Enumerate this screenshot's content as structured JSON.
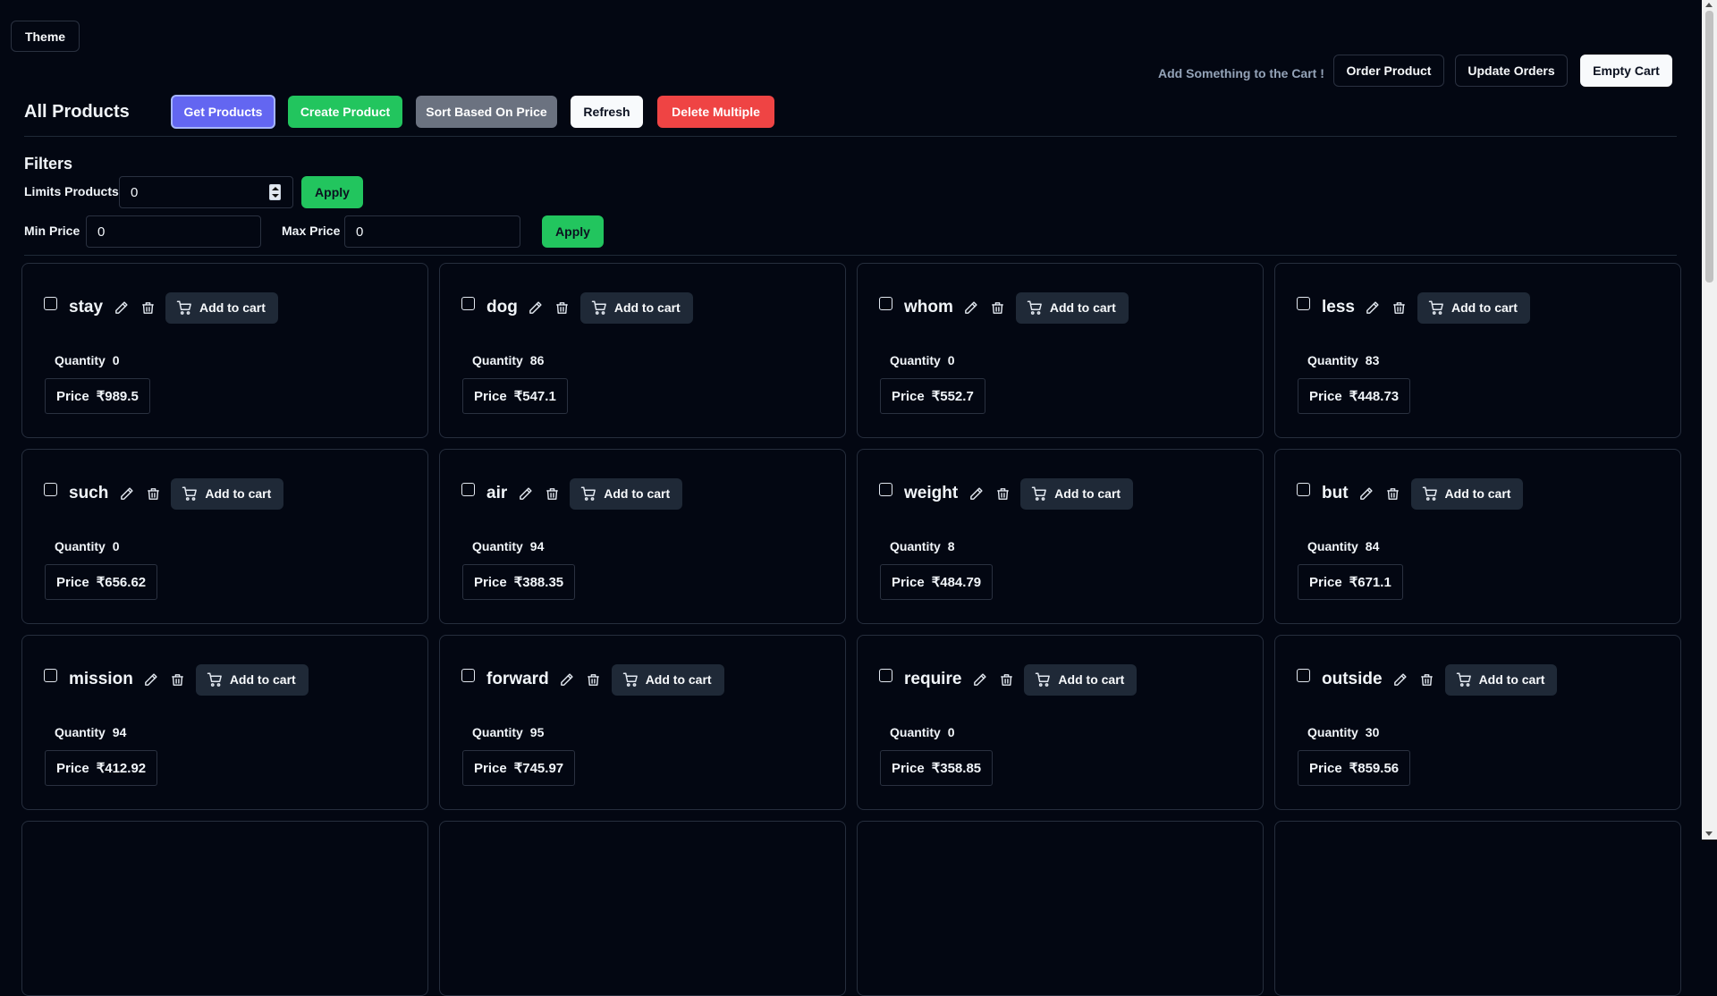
{
  "header": {
    "theme_label": "Theme",
    "cart_message": "Add Something to the Cart !",
    "order_product_label": "Order Product",
    "update_orders_label": "Update Orders",
    "empty_cart_label": "Empty Cart"
  },
  "toolbar": {
    "title": "All Products",
    "get_products_label": "Get Products",
    "create_product_label": "Create Product",
    "sort_label": "Sort Based On Price",
    "refresh_label": "Refresh",
    "delete_multiple_label": "Delete Multiple"
  },
  "filters": {
    "title": "Filters",
    "limit_label": "Limits Products",
    "limit_value": "0",
    "apply_label": "Apply",
    "min_price_label": "Min Price",
    "min_price_value": "0",
    "max_price_label": "Max Price",
    "max_price_value": "0"
  },
  "card_labels": {
    "add_to_cart": "Add to cart",
    "quantity": "Quantity",
    "price": "Price"
  },
  "products": [
    {
      "name": "stay",
      "quantity": "0",
      "price": "₹989.5"
    },
    {
      "name": "dog",
      "quantity": "86",
      "price": "₹547.1"
    },
    {
      "name": "whom",
      "quantity": "0",
      "price": "₹552.7"
    },
    {
      "name": "less",
      "quantity": "83",
      "price": "₹448.73"
    },
    {
      "name": "such",
      "quantity": "0",
      "price": "₹656.62"
    },
    {
      "name": "air",
      "quantity": "94",
      "price": "₹388.35"
    },
    {
      "name": "weight",
      "quantity": "8",
      "price": "₹484.79"
    },
    {
      "name": "but",
      "quantity": "84",
      "price": "₹671.1"
    },
    {
      "name": "mission",
      "quantity": "94",
      "price": "₹412.92"
    },
    {
      "name": "forward",
      "quantity": "95",
      "price": "₹745.97"
    },
    {
      "name": "require",
      "quantity": "0",
      "price": "₹358.85"
    },
    {
      "name": "outside",
      "quantity": "30",
      "price": "₹859.56"
    }
  ],
  "colors": {
    "background": "#030712",
    "get_products": "#6366f1",
    "create_product": "#22c55e",
    "sort": "#6b7280",
    "delete": "#ef4444",
    "apply": "#22c55e",
    "cart_button": "#1f2937"
  }
}
